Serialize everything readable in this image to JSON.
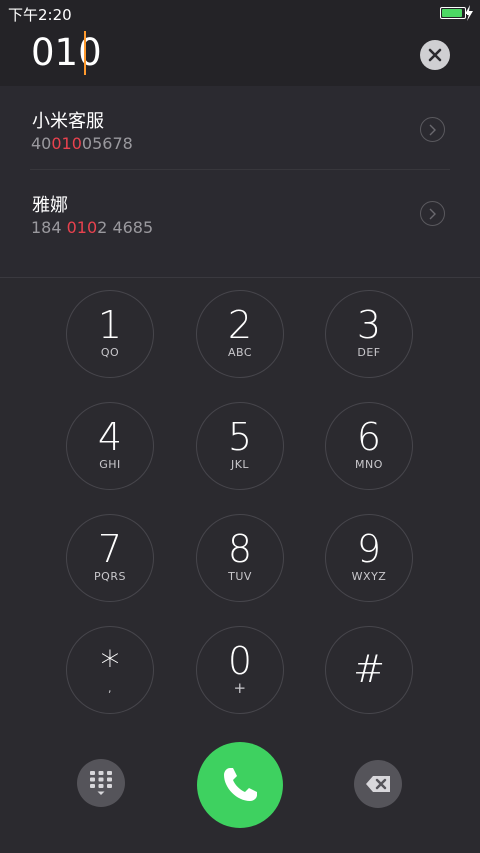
{
  "status_bar": {
    "time": "下午2:20"
  },
  "dial_input": {
    "value": "010"
  },
  "contacts": [
    {
      "name": "小米客服",
      "number_pre": "40",
      "number_match": "010",
      "number_post": "05678"
    },
    {
      "name": "雅娜",
      "number_pre": "184 ",
      "number_match": "010",
      "number_post": "2 4685"
    }
  ],
  "keys": [
    {
      "digit": "1",
      "letters": "QO"
    },
    {
      "digit": "2",
      "letters": "ABC"
    },
    {
      "digit": "3",
      "letters": "DEF"
    },
    {
      "digit": "4",
      "letters": "GHI"
    },
    {
      "digit": "5",
      "letters": "JKL"
    },
    {
      "digit": "6",
      "letters": "MNO"
    },
    {
      "digit": "7",
      "letters": "PQRS"
    },
    {
      "digit": "8",
      "letters": "TUV"
    },
    {
      "digit": "9",
      "letters": "WXYZ"
    },
    {
      "digit": "*",
      "letters": ","
    },
    {
      "digit": "0",
      "letters": "+"
    },
    {
      "digit": "#",
      "letters": ""
    }
  ],
  "colors": {
    "background": "#2b2a2f",
    "accent_cursor": "#ff9a2e",
    "match_highlight": "#e8424e",
    "call_green": "#3ed160",
    "battery_green": "#4cd964"
  },
  "icons": {
    "clear": "close-circle-icon",
    "detail": "chevron-right-circle-icon",
    "dialpad": "grid-dialpad-icon",
    "call": "phone-icon",
    "backspace": "backspace-icon",
    "battery": "battery-charging-icon"
  }
}
